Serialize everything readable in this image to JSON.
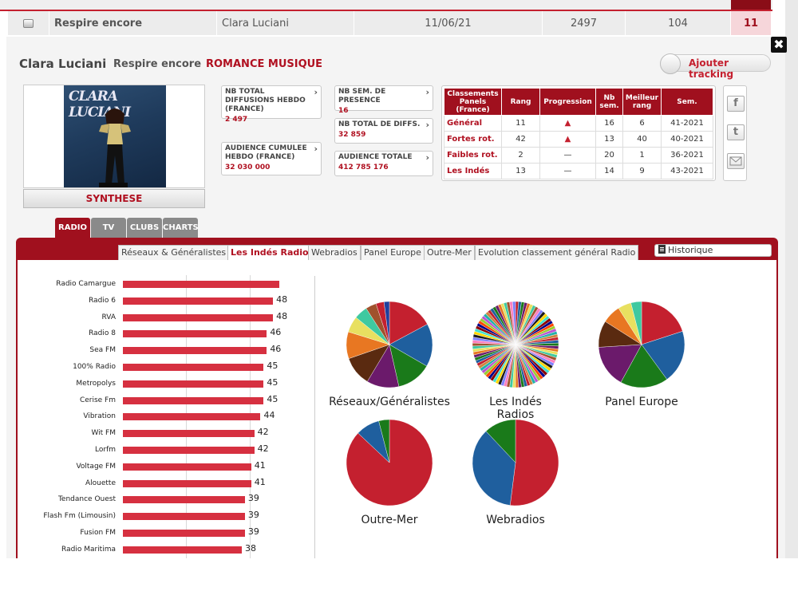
{
  "top_row": {
    "title": "Respire encore",
    "artist": "Clara Luciani",
    "date": "11/06/21",
    "value1": "2497",
    "value2": "104",
    "value3": "11"
  },
  "header": {
    "artist": "Clara Luciani",
    "title": "Respire encore",
    "genre": "ROMANCE MUSIQUE",
    "tracking_label": "Ajouter tracking",
    "close_icon": "close-icon"
  },
  "cover": {
    "title_text": "CLARA LUCIANI",
    "synthese_label": "SYNTHESE"
  },
  "stats": [
    {
      "label": "NB TOTAL DIFFUSIONS HEBDO (FRANCE)",
      "value": "2 497"
    },
    {
      "label": "AUDIENCE CUMULEE HEBDO (FRANCE)",
      "value": "32 030 000"
    },
    {
      "label": "NB SEM. DE PRESENCE",
      "value": "16"
    },
    {
      "label": "NB TOTAL DE DIFFS.",
      "value": "32 859"
    },
    {
      "label": "AUDIENCE TOTALE",
      "value": "412 785 176"
    }
  ],
  "rankings": {
    "headers": [
      "Classements Panels (France)",
      "Rang",
      "Progression",
      "Nb sem.",
      "Meilleur rang",
      "Sem."
    ],
    "rows": [
      {
        "name": "Général",
        "rang": "11",
        "prog": "up",
        "nb": "16",
        "best": "6",
        "sem": "41-2021"
      },
      {
        "name": "Fortes rot.",
        "rang": "42",
        "prog": "up",
        "nb": "13",
        "best": "40",
        "sem": "40-2021"
      },
      {
        "name": "Faibles rot.",
        "rang": "2",
        "prog": "flat",
        "nb": "20",
        "best": "1",
        "sem": "36-2021"
      },
      {
        "name": "Les Indés",
        "rang": "13",
        "prog": "flat",
        "nb": "14",
        "best": "9",
        "sem": "43-2021"
      }
    ]
  },
  "share": {
    "facebook": "f",
    "twitter": "t",
    "mail_icon": "mail-icon"
  },
  "media_tabs": [
    "RADIO",
    "TV",
    "CLUBS",
    "CHARTS"
  ],
  "sub_tabs": [
    "Réseaux & Généralistes",
    "Les Indés Radios",
    "Webradios",
    "Panel Europe",
    "Outre-Mer",
    "Evolution classement général Radio"
  ],
  "historique_label": "Historique",
  "bar_chart": {
    "type": "bar",
    "orientation": "horizontal",
    "categories": [
      "Radio Camargue",
      "Radio 6",
      "RVA",
      "Radio 8",
      "Sea FM",
      "100% Radio",
      "Metropolys",
      "Cerise Fm",
      "Vibration",
      "Wit FM",
      "Lorfm",
      "Voltage FM",
      "Alouette",
      "Tendance Ouest",
      "Flash Fm (Limousin)",
      "Fusion FM",
      "Radio Maritima"
    ],
    "values": [
      50,
      48,
      48,
      46,
      46,
      45,
      45,
      45,
      44,
      42,
      42,
      41,
      41,
      39,
      39,
      39,
      38
    ],
    "value_labels": [
      "",
      "48",
      "48",
      "46",
      "46",
      "45",
      "45",
      "45",
      "44",
      "42",
      "42",
      "41",
      "41",
      "39",
      "39",
      "39",
      "38"
    ],
    "bar_color": "#d63040"
  },
  "pies": [
    {
      "label": "Réseaux/Généralistes",
      "slices": [
        {
          "value": 17,
          "color": "#c4202f"
        },
        {
          "value": 16,
          "color": "#1f5f9e"
        },
        {
          "value": 13,
          "color": "#1a7a1a"
        },
        {
          "value": 12,
          "color": "#6b1a6b"
        },
        {
          "value": 11,
          "color": "#5a2a10"
        },
        {
          "value": 10,
          "color": "#e87722"
        },
        {
          "value": 6,
          "color": "#e8e060"
        },
        {
          "value": 5,
          "color": "#3fc9a0"
        },
        {
          "value": 4,
          "color": "#a0522d"
        },
        {
          "value": 3,
          "color": "#c4202f"
        },
        {
          "value": 2,
          "color": "#1f3f9e"
        }
      ]
    },
    {
      "label": "Les Indés Radios",
      "many": true
    },
    {
      "label": "Panel Europe",
      "slices": [
        {
          "value": 20,
          "color": "#c4202f"
        },
        {
          "value": 20,
          "color": "#1f5f9e"
        },
        {
          "value": 18,
          "color": "#1a7a1a"
        },
        {
          "value": 16,
          "color": "#6b1a6b"
        },
        {
          "value": 10,
          "color": "#5a2a10"
        },
        {
          "value": 7,
          "color": "#e87722"
        },
        {
          "value": 5,
          "color": "#e8e060"
        },
        {
          "value": 4,
          "color": "#3fc9a0"
        }
      ]
    },
    {
      "label": "Outre-Mer",
      "slices": [
        {
          "value": 87,
          "color": "#c4202f"
        },
        {
          "value": 9,
          "color": "#1f5f9e"
        },
        {
          "value": 4,
          "color": "#1a7a1a"
        }
      ]
    },
    {
      "label": "Webradios",
      "slices": [
        {
          "value": 52,
          "color": "#c4202f"
        },
        {
          "value": 36,
          "color": "#1f5f9e"
        },
        {
          "value": 12,
          "color": "#1a7a1a"
        }
      ]
    }
  ]
}
